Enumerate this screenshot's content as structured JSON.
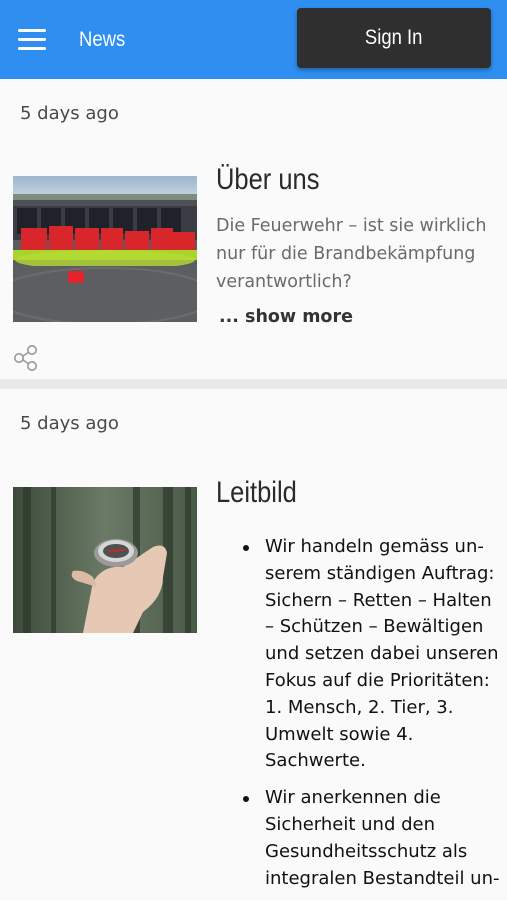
{
  "header": {
    "title": "News",
    "sign_in_label": "Sign In",
    "accent_color": "#2f8ff1"
  },
  "posts": [
    {
      "date": "5 days ago",
      "title": "Über uns",
      "excerpt": "Die Feuerwehr – ist sie wirklich nur für die Brandbekämpfung verantwortlich?",
      "show_more": "... show more",
      "image_icon": "fire-station-photo",
      "share_icon": "share-icon"
    },
    {
      "date": "5 days ago",
      "title": "Leitbild",
      "image_icon": "compass-photo",
      "bullets": [
        "Wir handeln gemäss un-serem ständigen Auftrag: Sichern – Retten – Halten – Schützen – Bewältigen und setzen dabei unseren Fokus auf die Prioritäten: 1. Mensch, 2. Tier, 3. Umwelt sowie 4. Sachwerte.",
        "Wir anerkennen die Sicherheit und den Gesundheitsschutz als integralen Bestandteil un-"
      ]
    }
  ]
}
